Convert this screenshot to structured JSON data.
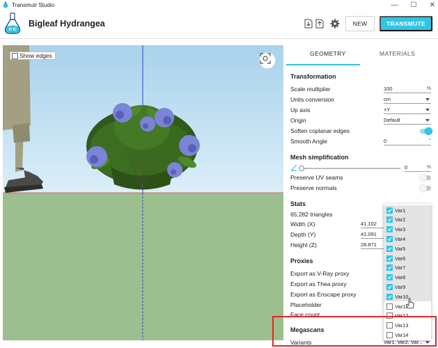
{
  "window": {
    "title": "Transmutr Studio",
    "controls": [
      "—",
      "☐",
      "✕"
    ]
  },
  "header": {
    "project_name": "Bigleaf Hydrangea",
    "new_label": "NEW",
    "transmute_label": "TRANSMUTE",
    "accent_color": "#2ec6e6"
  },
  "viewport": {
    "show_edges_label": "Show edges",
    "show_edges_checked": false
  },
  "tabs": [
    {
      "label": "GEOMETRY",
      "active": true
    },
    {
      "label": "MATERIALS",
      "active": false
    }
  ],
  "transformation": {
    "title": "Transformation",
    "scale_label": "Scale multiplier",
    "scale_value": "100",
    "scale_unit": "%",
    "units_label": "Units conversion",
    "units_value": "cm",
    "up_axis_label": "Up axis",
    "up_axis_value": "+Y",
    "origin_label": "Origin",
    "origin_value": "Default",
    "soften_label": "Soften coplanar edges",
    "soften_on": true,
    "smooth_label": "Smooth Angle",
    "smooth_value": "0",
    "smooth_unit": "°"
  },
  "mesh": {
    "title": "Mesh simplification",
    "simplification_value": "0",
    "simplification_unit": "%",
    "uv_label": "Preserve UV seams",
    "uv_on": false,
    "normals_label": "Preserve normals",
    "normals_on": false
  },
  "stats": {
    "title": "Stats",
    "triangles": "65,282 triangles",
    "width_label": "Width (X)",
    "width_value": "41.102",
    "depth_label": "Depth (Y)",
    "depth_value": "41.091",
    "height_label": "Height (Z)",
    "height_value": "28.871"
  },
  "proxies": {
    "title": "Proxies",
    "vray_label": "Export as V-Ray proxy",
    "thea_label": "Export as Thea proxy",
    "enscape_label": "Export as Enscape proxy",
    "placeholder_label": "Placeholder",
    "face_count_label": "Face count"
  },
  "megascans": {
    "title": "Megascans",
    "variants_label": "Variants",
    "variants_value": "Var1, Var2, Var..."
  },
  "variants_dropdown": [
    {
      "label": "Var1",
      "checked": true
    },
    {
      "label": "Var2",
      "checked": true
    },
    {
      "label": "Var3",
      "checked": true
    },
    {
      "label": "Var4",
      "checked": true
    },
    {
      "label": "Var5",
      "checked": true
    },
    {
      "label": "Var6",
      "checked": true
    },
    {
      "label": "Var7",
      "checked": true
    },
    {
      "label": "Var8",
      "checked": true
    },
    {
      "label": "Var9",
      "checked": true
    },
    {
      "label": "Var10",
      "checked": true
    },
    {
      "label": "Var11",
      "checked": false
    },
    {
      "label": "Var12",
      "checked": false
    },
    {
      "label": "Var13",
      "checked": false
    },
    {
      "label": "Var14",
      "checked": false
    }
  ]
}
